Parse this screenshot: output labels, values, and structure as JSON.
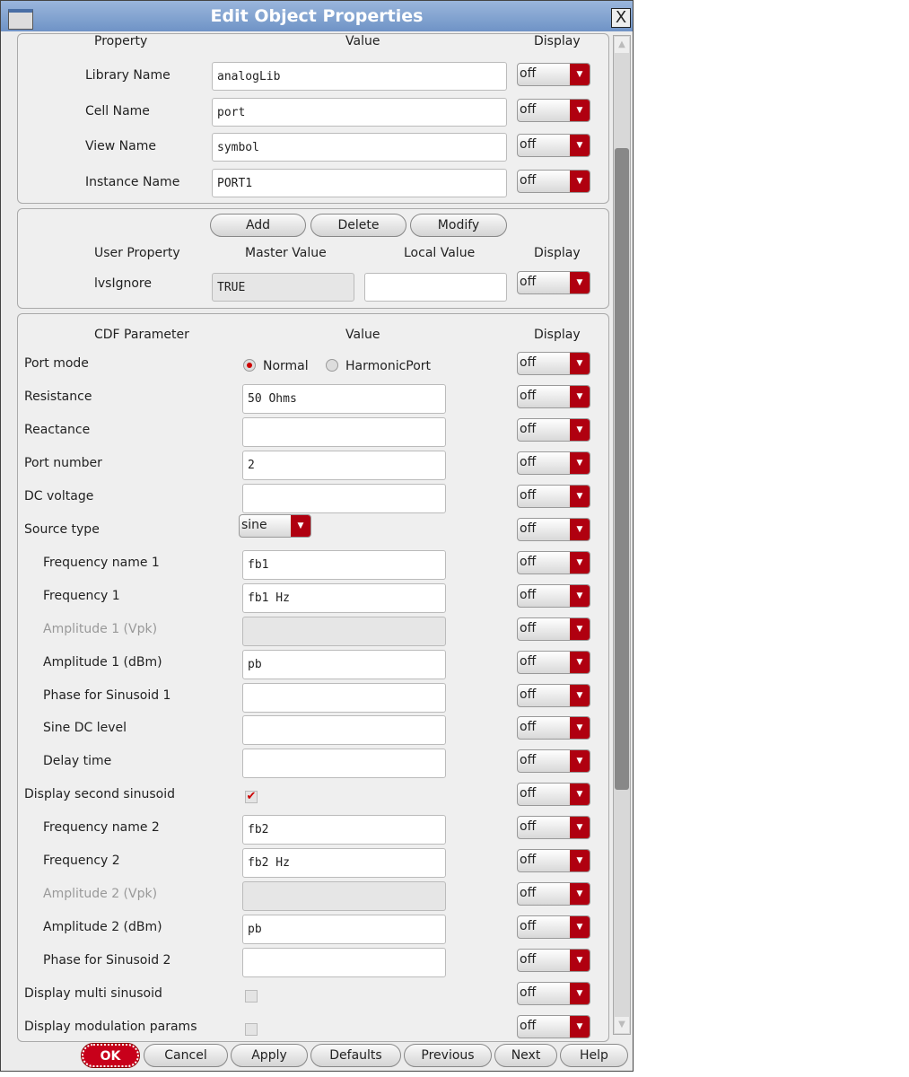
{
  "window": {
    "title": "Edit Object Properties",
    "close": "X"
  },
  "props": {
    "headers": [
      "Property",
      "Value",
      "Display"
    ],
    "rows": [
      {
        "label": "Library Name",
        "value": "analogLib",
        "display": "off"
      },
      {
        "label": "Cell Name",
        "value": "port",
        "display": "off"
      },
      {
        "label": "View Name",
        "value": "symbol",
        "display": "off"
      },
      {
        "label": "Instance Name",
        "value": "PORT1",
        "display": "off"
      }
    ]
  },
  "user": {
    "buttons": [
      "Add",
      "Delete",
      "Modify"
    ],
    "headers": [
      "User Property",
      "Master Value",
      "Local Value",
      "Display"
    ],
    "rows": [
      {
        "label": "lvsIgnore",
        "master": "TRUE",
        "local": "",
        "display": "off"
      }
    ]
  },
  "cdf": {
    "headers": [
      "CDF Parameter",
      "Value",
      "Display"
    ],
    "rows": [
      {
        "label": "Port mode",
        "type": "radio",
        "options": [
          "Normal",
          "HarmonicPort"
        ],
        "selected": "Normal",
        "display": "off"
      },
      {
        "label": "Resistance",
        "type": "text",
        "value": "50  Ohms",
        "display": "off"
      },
      {
        "label": "Reactance",
        "type": "text",
        "value": "",
        "display": "off"
      },
      {
        "label": "Port number",
        "type": "text",
        "value": "2",
        "display": "off"
      },
      {
        "label": "DC voltage",
        "type": "text",
        "value": "",
        "display": "off"
      },
      {
        "label": "Source type",
        "type": "select",
        "value": "sine",
        "display": "off"
      },
      {
        "label": "Frequency name 1",
        "type": "text",
        "value": "fb1",
        "indent": true,
        "display": "off"
      },
      {
        "label": "Frequency 1",
        "type": "text",
        "value": "fb1 Hz",
        "indent": true,
        "display": "off"
      },
      {
        "label": "Amplitude 1 (Vpk)",
        "type": "text",
        "value": "",
        "indent": true,
        "disabled": true,
        "display": "off"
      },
      {
        "label": "Amplitude 1 (dBm)",
        "type": "text",
        "value": "pb",
        "indent": true,
        "display": "off"
      },
      {
        "label": "Phase for Sinusoid 1",
        "type": "text",
        "value": "",
        "indent": true,
        "display": "off"
      },
      {
        "label": "Sine DC level",
        "type": "text",
        "value": "",
        "indent": true,
        "display": "off"
      },
      {
        "label": "Delay time",
        "type": "text",
        "value": "",
        "indent": true,
        "display": "off"
      },
      {
        "label": "Display second sinusoid",
        "type": "check",
        "checked": true,
        "display": "off"
      },
      {
        "label": "Frequency name 2",
        "type": "text",
        "value": "fb2",
        "indent": true,
        "display": "off"
      },
      {
        "label": "Frequency 2",
        "type": "text",
        "value": "fb2  Hz",
        "indent": true,
        "display": "off"
      },
      {
        "label": "Amplitude 2 (Vpk)",
        "type": "text",
        "value": "",
        "indent": true,
        "disabled": true,
        "display": "off"
      },
      {
        "label": "Amplitude 2 (dBm)",
        "type": "text",
        "value": "pb",
        "indent": true,
        "display": "off"
      },
      {
        "label": "Phase for Sinusoid 2",
        "type": "text",
        "value": "",
        "indent": true,
        "display": "off"
      },
      {
        "label": "Display multi sinusoid",
        "type": "check",
        "checked": false,
        "display": "off"
      },
      {
        "label": "Display modulation params",
        "type": "check",
        "checked": false,
        "display": "off"
      }
    ]
  },
  "footer": {
    "buttons": [
      "OK",
      "Cancel",
      "Apply",
      "Defaults",
      "Previous",
      "Next",
      "Help"
    ]
  },
  "colors": {
    "accent": "#b00010",
    "title_bar": "#7fa0cc"
  }
}
